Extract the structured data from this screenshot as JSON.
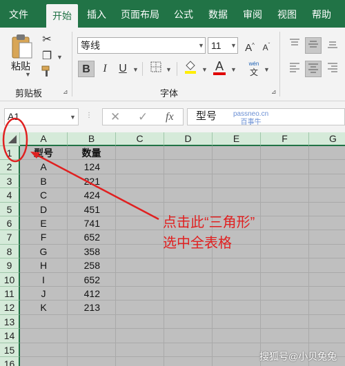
{
  "ribbon_tabs": [
    "文件",
    "开始",
    "插入",
    "页面布局",
    "公式",
    "数据",
    "审阅",
    "视图",
    "帮助"
  ],
  "active_tab": "开始",
  "clipboard": {
    "paste_label": "粘贴",
    "group_label": "剪贴板"
  },
  "font": {
    "name": "等线",
    "size": "11",
    "group_label": "字体",
    "bold": "B",
    "italic": "I",
    "underline": "U",
    "grow": "A",
    "shrink": "A",
    "font_color": "A",
    "phonetic": "文"
  },
  "formula_bar": {
    "name_box": "A1",
    "formula": "型号",
    "fx": "fx",
    "cancel": "✕",
    "enter": "✓",
    "overlay_line1": "passneo.cn",
    "overlay_line2": "百事牛"
  },
  "columns": [
    "A",
    "B",
    "C",
    "D",
    "E",
    "F",
    "G"
  ],
  "rows": [
    "1",
    "2",
    "3",
    "4",
    "5",
    "6",
    "7",
    "8",
    "9",
    "10",
    "11",
    "12",
    "13",
    "14",
    "15",
    "16"
  ],
  "table": {
    "headers": [
      "型号",
      "数量"
    ],
    "data": [
      [
        "A",
        "124"
      ],
      [
        "B",
        "221"
      ],
      [
        "C",
        "424"
      ],
      [
        "D",
        "451"
      ],
      [
        "E",
        "741"
      ],
      [
        "F",
        "652"
      ],
      [
        "G",
        "358"
      ],
      [
        "H",
        "258"
      ],
      [
        "I",
        "652"
      ],
      [
        "J",
        "412"
      ],
      [
        "K",
        "213"
      ]
    ]
  },
  "annotation": {
    "line1": "点击此“三角形”",
    "line2": "选中全表格",
    "color": "#e02020"
  },
  "watermark": "搜狐号@小贝兔兔",
  "colors": {
    "accent": "#217346",
    "header_bg": "#d5ead9",
    "selection": "#bfbfbf"
  }
}
